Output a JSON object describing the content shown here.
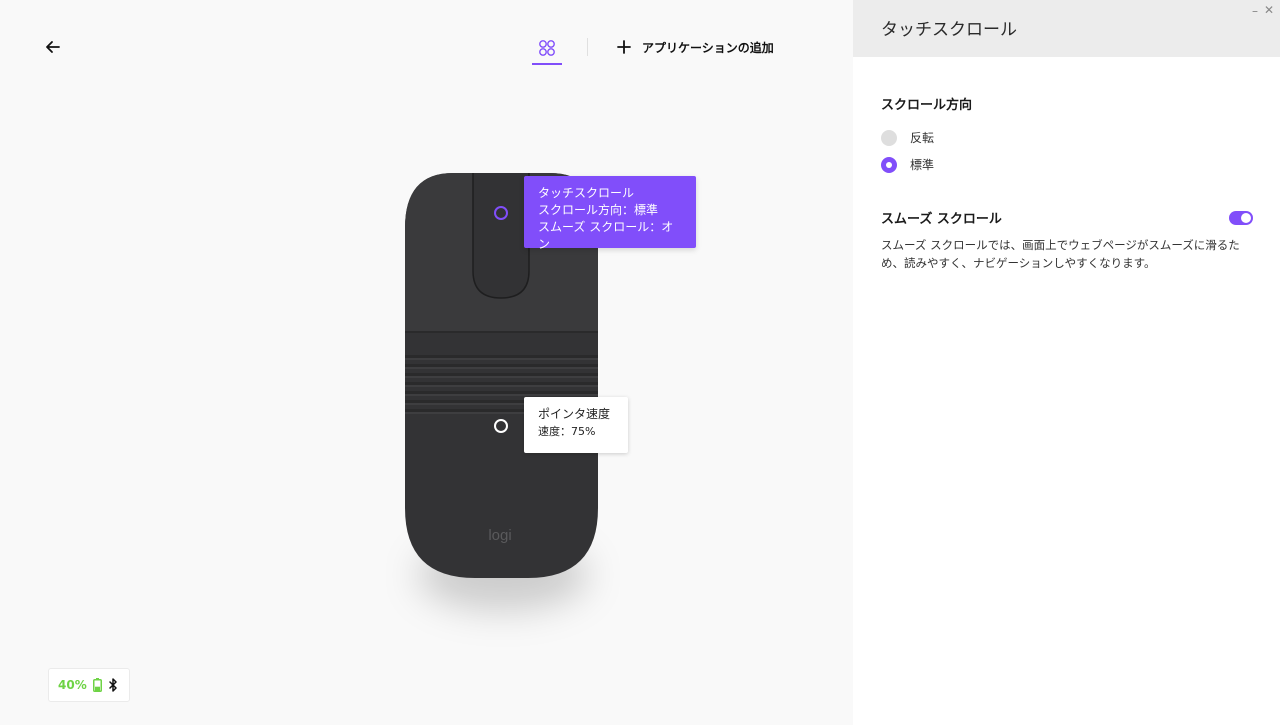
{
  "toolbar": {
    "add_app_label": "アプリケーションの追加"
  },
  "mouse": {
    "brand": "logi"
  },
  "callouts": {
    "touch_scroll": {
      "title": "タッチスクロール",
      "line1": "スクロール方向：標準",
      "line2": "スムーズ スクロール：オン"
    },
    "pointer_speed": {
      "title": "ポインタ速度",
      "line1": "速度：75%"
    }
  },
  "battery": {
    "percent": "40%",
    "level": 0.4,
    "color": "#6ed345"
  },
  "panel": {
    "title": "タッチスクロール",
    "scroll_direction": {
      "label": "スクロール方向",
      "options": [
        {
          "label": "反転",
          "selected": false
        },
        {
          "label": "標準",
          "selected": true
        }
      ]
    },
    "smooth_scroll": {
      "label": "スムーズ スクロール",
      "enabled": true,
      "description": "スムーズ スクロールでは、画面上でウェブページがスムーズに滑るため、読みやすく、ナビゲーションしやすくなります。"
    }
  },
  "colors": {
    "accent": "#814efa",
    "mouse_body": "#333335"
  },
  "icons": {
    "back": "arrow-left-icon",
    "apps": "apps-grid-icon",
    "add": "plus-icon",
    "battery": "battery-icon",
    "bluetooth": "bluetooth-icon"
  }
}
